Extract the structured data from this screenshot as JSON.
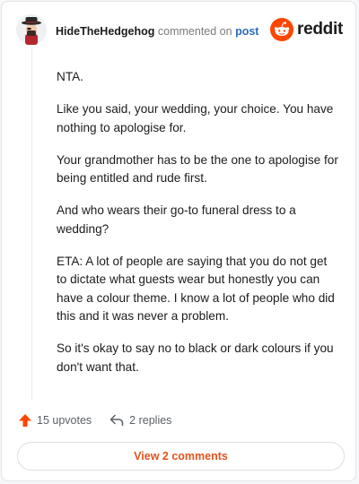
{
  "comment": {
    "username": "HideTheHedgehog",
    "action_text": "commented on",
    "post_link": "post",
    "paragraphs": [
      "NTA.",
      "Like you said, your wedding, your choice. You have nothing to apologise for.",
      "Your grandmother has to be the one to apologise for being entitled and rude first.",
      "And who wears their go-to funeral dress to a wedding?",
      "ETA: A lot of people are saying that you do not get to dictate what guests wear but honestly you can have a colour theme. I know a lot of people who did this and it was never a problem.",
      "So it's okay to say no to black or dark colours if you don't want that."
    ]
  },
  "brand": {
    "wordmark": "reddit",
    "icon": "reddit-snoo-icon",
    "color": "#ff4500"
  },
  "actions": {
    "upvotes_label": "15 upvotes",
    "upvote_icon": "upvote-arrow-icon",
    "upvote_color": "#ff4500",
    "replies_label": "2 replies",
    "reply_icon": "reply-arrow-icon"
  },
  "footer": {
    "view_comments_label": "View 2 comments",
    "accent": "#e0541f"
  },
  "icons": {
    "avatar": "pirate-avatar-icon"
  }
}
